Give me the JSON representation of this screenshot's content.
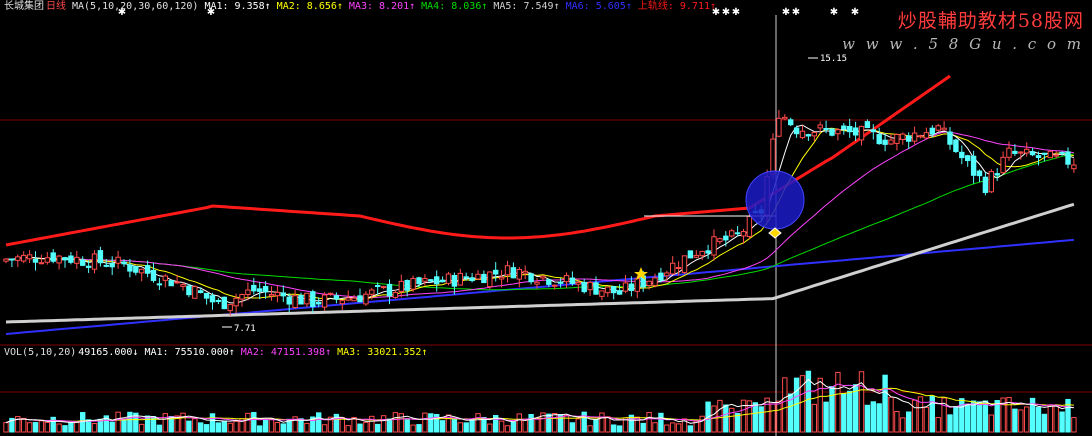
{
  "header": {
    "stock_name": "长城集团",
    "period": "日线",
    "ma_params": "MA(5,10,20,30,60,120)",
    "ma1": "MA1: 9.358↑",
    "ma2": "MA2: 8.656↑",
    "ma3": "MA3: 8.201↑",
    "ma4": "MA4: 8.036↑",
    "ma5": "MA5: 7.549↑",
    "ma6": "MA6: 5.605↑",
    "upper_line": "上轨线: 9.711↑"
  },
  "volume_header": {
    "params": "VOL(5,10,20)",
    "vol": "49165.000↓",
    "ma1": "MA1: 75510.000↑",
    "ma2": "MA2: 47151.398↑",
    "ma3": "MA3: 33021.352↑"
  },
  "watermark": {
    "title": "炒股輔助教材58股网",
    "url": "w w w . 5 8 G u . c o m"
  },
  "colors": {
    "up": "#ff4b4b",
    "down": "#54ffff",
    "ma1": "#ffffff",
    "ma2": "#ffff00",
    "ma3": "#ff44ff",
    "ma4": "#00dd00",
    "ma5": "#d0d0d0",
    "ma6": "#3030ff",
    "upper": "#ff1a1a",
    "grid": "#800000"
  },
  "chart_data": {
    "type": "candlestick",
    "annotations": {
      "low_label": "7.71",
      "high_label": "15.15"
    },
    "price_range": [
      7.0,
      16.5
    ],
    "notes": "Daily K-line with moving averages; values estimated from price path.",
    "series": []
  }
}
